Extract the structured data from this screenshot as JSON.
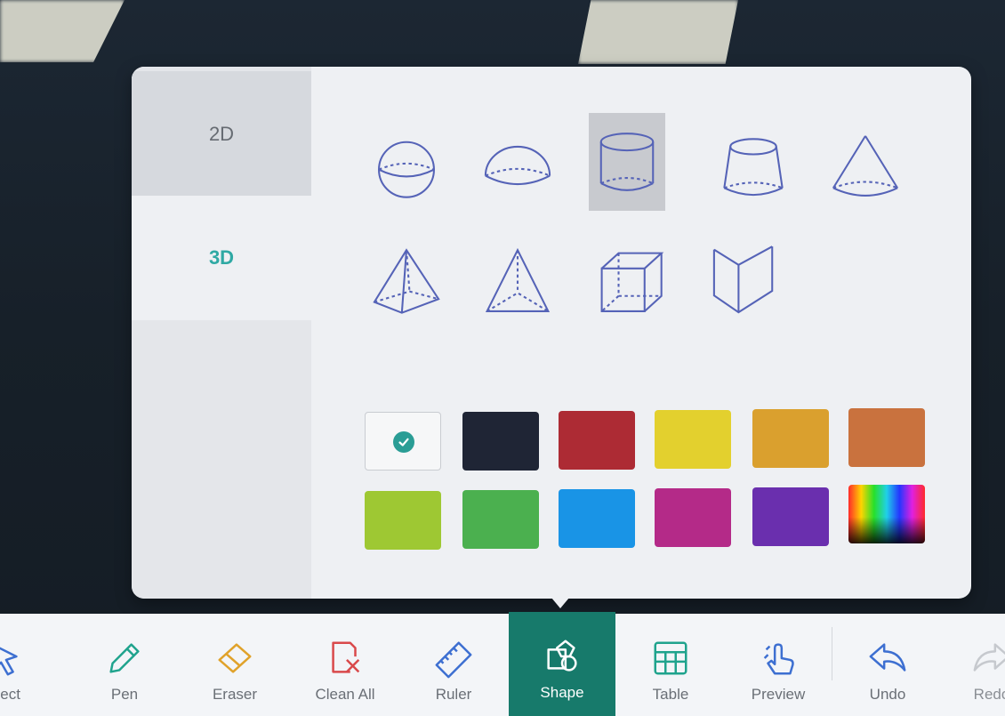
{
  "sidebar": {
    "tabs": [
      {
        "label": "2D",
        "selected": false
      },
      {
        "label": "3D",
        "selected": true
      }
    ]
  },
  "shapes": {
    "row1": [
      "sphere-icon",
      "hemisphere-icon",
      "cylinder-icon",
      "frustum-icon",
      "cone-icon"
    ],
    "row2": [
      "square-pyramid-icon",
      "triangular-pyramid-icon",
      "cube-icon",
      "open-book-prism-icon"
    ],
    "selected": "cylinder-icon"
  },
  "colors": {
    "row1": [
      "#ffffff",
      "#1f2535",
      "#ad2b34",
      "#e3d02e",
      "#daa02e",
      "#c9723e"
    ],
    "row2": [
      "#9ec833",
      "#4bb04f",
      "#1994e6",
      "#b42a88",
      "#6a2fae",
      "spectrum"
    ],
    "selected_index": 0,
    "accent": "#2a9d95"
  },
  "toolbar": {
    "items": [
      {
        "label": "elect",
        "icon": "select-cursor-icon"
      },
      {
        "label": "Pen",
        "icon": "pen-icon"
      },
      {
        "label": "Eraser",
        "icon": "eraser-icon"
      },
      {
        "label": "Clean All",
        "icon": "clean-all-icon"
      },
      {
        "label": "Ruler",
        "icon": "ruler-icon"
      },
      {
        "label": "Shape",
        "icon": "shape-icon",
        "active": true
      },
      {
        "label": "Table",
        "icon": "table-icon"
      },
      {
        "label": "Preview",
        "icon": "preview-hand-icon"
      },
      {
        "label": "Undo",
        "icon": "undo-icon"
      },
      {
        "label": "Redo",
        "icon": "redo-icon"
      }
    ],
    "active_color": "#177a6b",
    "icon_color": "#3d6fd1"
  }
}
